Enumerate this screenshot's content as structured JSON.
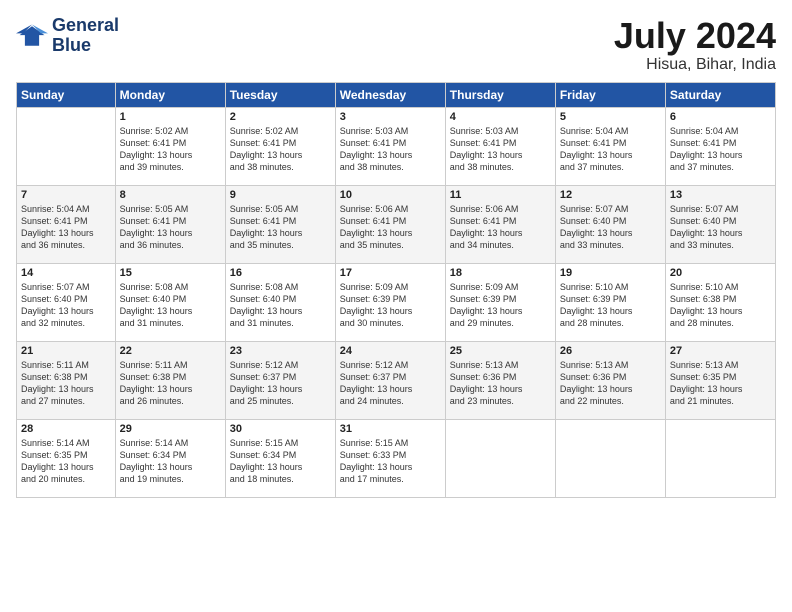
{
  "header": {
    "logo_line1": "General",
    "logo_line2": "Blue",
    "title": "July 2024",
    "subtitle": "Hisua, Bihar, India"
  },
  "weekdays": [
    "Sunday",
    "Monday",
    "Tuesday",
    "Wednesday",
    "Thursday",
    "Friday",
    "Saturday"
  ],
  "weeks": [
    [
      {
        "day": "",
        "empty": true
      },
      {
        "day": "1",
        "sunrise": "5:02 AM",
        "sunset": "6:41 PM",
        "daylight": "13 hours and 39 minutes."
      },
      {
        "day": "2",
        "sunrise": "5:02 AM",
        "sunset": "6:41 PM",
        "daylight": "13 hours and 38 minutes."
      },
      {
        "day": "3",
        "sunrise": "5:03 AM",
        "sunset": "6:41 PM",
        "daylight": "13 hours and 38 minutes."
      },
      {
        "day": "4",
        "sunrise": "5:03 AM",
        "sunset": "6:41 PM",
        "daylight": "13 hours and 38 minutes."
      },
      {
        "day": "5",
        "sunrise": "5:04 AM",
        "sunset": "6:41 PM",
        "daylight": "13 hours and 37 minutes."
      },
      {
        "day": "6",
        "sunrise": "5:04 AM",
        "sunset": "6:41 PM",
        "daylight": "13 hours and 37 minutes."
      }
    ],
    [
      {
        "day": "7",
        "sunrise": "5:04 AM",
        "sunset": "6:41 PM",
        "daylight": "13 hours and 36 minutes."
      },
      {
        "day": "8",
        "sunrise": "5:05 AM",
        "sunset": "6:41 PM",
        "daylight": "13 hours and 36 minutes."
      },
      {
        "day": "9",
        "sunrise": "5:05 AM",
        "sunset": "6:41 PM",
        "daylight": "13 hours and 35 minutes."
      },
      {
        "day": "10",
        "sunrise": "5:06 AM",
        "sunset": "6:41 PM",
        "daylight": "13 hours and 35 minutes."
      },
      {
        "day": "11",
        "sunrise": "5:06 AM",
        "sunset": "6:41 PM",
        "daylight": "13 hours and 34 minutes."
      },
      {
        "day": "12",
        "sunrise": "5:07 AM",
        "sunset": "6:40 PM",
        "daylight": "13 hours and 33 minutes."
      },
      {
        "day": "13",
        "sunrise": "5:07 AM",
        "sunset": "6:40 PM",
        "daylight": "13 hours and 33 minutes."
      }
    ],
    [
      {
        "day": "14",
        "sunrise": "5:07 AM",
        "sunset": "6:40 PM",
        "daylight": "13 hours and 32 minutes."
      },
      {
        "day": "15",
        "sunrise": "5:08 AM",
        "sunset": "6:40 PM",
        "daylight": "13 hours and 31 minutes."
      },
      {
        "day": "16",
        "sunrise": "5:08 AM",
        "sunset": "6:40 PM",
        "daylight": "13 hours and 31 minutes."
      },
      {
        "day": "17",
        "sunrise": "5:09 AM",
        "sunset": "6:39 PM",
        "daylight": "13 hours and 30 minutes."
      },
      {
        "day": "18",
        "sunrise": "5:09 AM",
        "sunset": "6:39 PM",
        "daylight": "13 hours and 29 minutes."
      },
      {
        "day": "19",
        "sunrise": "5:10 AM",
        "sunset": "6:39 PM",
        "daylight": "13 hours and 28 minutes."
      },
      {
        "day": "20",
        "sunrise": "5:10 AM",
        "sunset": "6:38 PM",
        "daylight": "13 hours and 28 minutes."
      }
    ],
    [
      {
        "day": "21",
        "sunrise": "5:11 AM",
        "sunset": "6:38 PM",
        "daylight": "13 hours and 27 minutes."
      },
      {
        "day": "22",
        "sunrise": "5:11 AM",
        "sunset": "6:38 PM",
        "daylight": "13 hours and 26 minutes."
      },
      {
        "day": "23",
        "sunrise": "5:12 AM",
        "sunset": "6:37 PM",
        "daylight": "13 hours and 25 minutes."
      },
      {
        "day": "24",
        "sunrise": "5:12 AM",
        "sunset": "6:37 PM",
        "daylight": "13 hours and 24 minutes."
      },
      {
        "day": "25",
        "sunrise": "5:13 AM",
        "sunset": "6:36 PM",
        "daylight": "13 hours and 23 minutes."
      },
      {
        "day": "26",
        "sunrise": "5:13 AM",
        "sunset": "6:36 PM",
        "daylight": "13 hours and 22 minutes."
      },
      {
        "day": "27",
        "sunrise": "5:13 AM",
        "sunset": "6:35 PM",
        "daylight": "13 hours and 21 minutes."
      }
    ],
    [
      {
        "day": "28",
        "sunrise": "5:14 AM",
        "sunset": "6:35 PM",
        "daylight": "13 hours and 20 minutes."
      },
      {
        "day": "29",
        "sunrise": "5:14 AM",
        "sunset": "6:34 PM",
        "daylight": "13 hours and 19 minutes."
      },
      {
        "day": "30",
        "sunrise": "5:15 AM",
        "sunset": "6:34 PM",
        "daylight": "13 hours and 18 minutes."
      },
      {
        "day": "31",
        "sunrise": "5:15 AM",
        "sunset": "6:33 PM",
        "daylight": "13 hours and 17 minutes."
      },
      {
        "day": "",
        "empty": true
      },
      {
        "day": "",
        "empty": true
      },
      {
        "day": "",
        "empty": true
      }
    ]
  ]
}
